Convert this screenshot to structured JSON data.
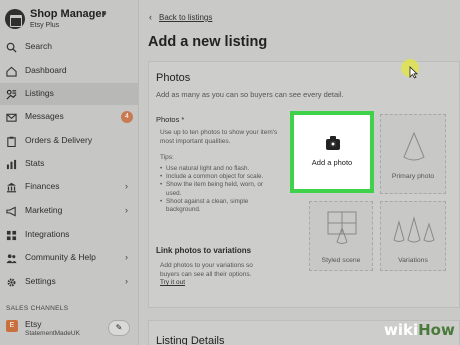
{
  "brand": {
    "title": "Shop Manager",
    "caret": "▾",
    "subtitle": "Etsy Plus"
  },
  "nav": [
    {
      "label": "Search",
      "icon": "search-icon"
    },
    {
      "label": "Dashboard",
      "icon": "home-icon"
    },
    {
      "label": "Listings",
      "icon": "listings-icon",
      "active": true
    },
    {
      "label": "Messages",
      "icon": "mail-icon",
      "badge": "4"
    },
    {
      "label": "Orders & Delivery",
      "icon": "clipboard-icon"
    },
    {
      "label": "Stats",
      "icon": "bar-chart-icon"
    },
    {
      "label": "Finances",
      "icon": "bank-icon",
      "chevron": "›"
    },
    {
      "label": "Marketing",
      "icon": "megaphone-icon",
      "chevron": "›"
    },
    {
      "label": "Integrations",
      "icon": "grid-icon"
    },
    {
      "label": "Community & Help",
      "icon": "people-icon",
      "chevron": "›"
    },
    {
      "label": "Settings",
      "icon": "gear-icon",
      "chevron": "›"
    }
  ],
  "sales_channels": {
    "label": "SALES CHANNELS",
    "shop_icon": "E",
    "shop_name": "Etsy",
    "shop_sub": "StatementMadeUK",
    "edit_icon": "✎"
  },
  "main": {
    "back_chevron": "‹",
    "back_link": "Back to listings",
    "title": "Add a new listing"
  },
  "photos": {
    "title": "Photos",
    "description": "Add as many as you can so buyers can see every detail.",
    "field_label": "Photos *",
    "field_help": "Use up to ten photos to show your item's most important qualities.",
    "tips_label": "Tips:",
    "tips": [
      "Use natural light and no flash.",
      "Include a common object for scale.",
      "Show the item being held, worn, or used.",
      "Shoot against a clean, simple background."
    ],
    "link_title": "Link photos to variations",
    "link_desc": "Add photos to your variations so buyers can see all their options.",
    "try_link": "Try it out",
    "add_photo_label": "Add a photo",
    "slots": [
      "Primary photo",
      "Styled scene",
      "Variations"
    ]
  },
  "listing_details": {
    "title": "Listing Details"
  },
  "watermark": {
    "wiki": "wiki",
    "how": "How"
  }
}
